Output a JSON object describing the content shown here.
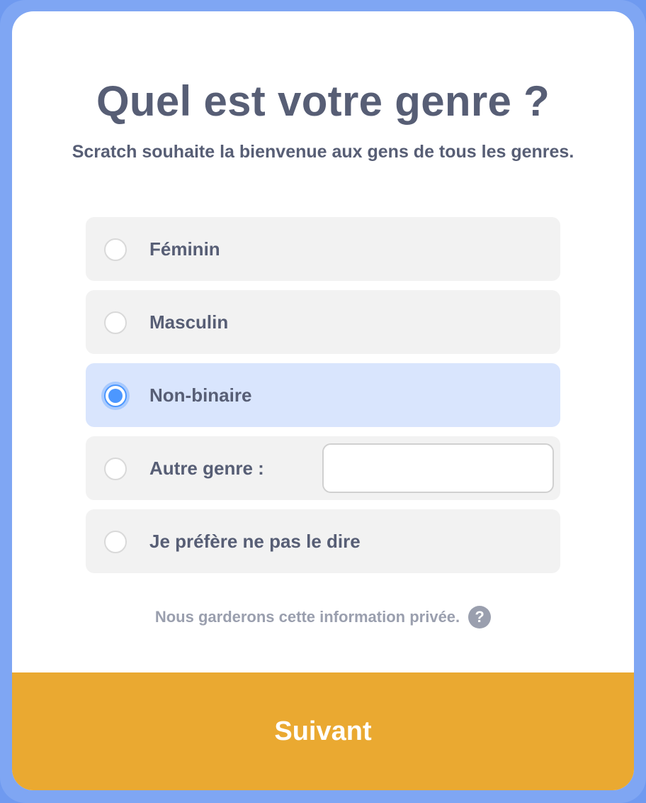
{
  "header": {
    "title": "Quel est votre genre ?",
    "subtitle": "Scratch souhaite la bienvenue aux gens de tous les genres."
  },
  "options": [
    {
      "label": "Féminin",
      "selected": false
    },
    {
      "label": "Masculin",
      "selected": false
    },
    {
      "label": "Non-binaire",
      "selected": true
    },
    {
      "label": "Autre genre :",
      "selected": false,
      "input_value": "",
      "input_placeholder": ""
    },
    {
      "label": "Je préfère ne pas le dire",
      "selected": false
    }
  ],
  "privacy": {
    "text": "Nous garderons cette information privée.",
    "help_icon": "?"
  },
  "footer": {
    "next_label": "Suivant"
  },
  "colors": {
    "frame": "#7fa6f3",
    "accent": "#4c97ff",
    "selected_bg": "#d9e5fd",
    "button": "#eaa931",
    "text": "#575e75"
  }
}
